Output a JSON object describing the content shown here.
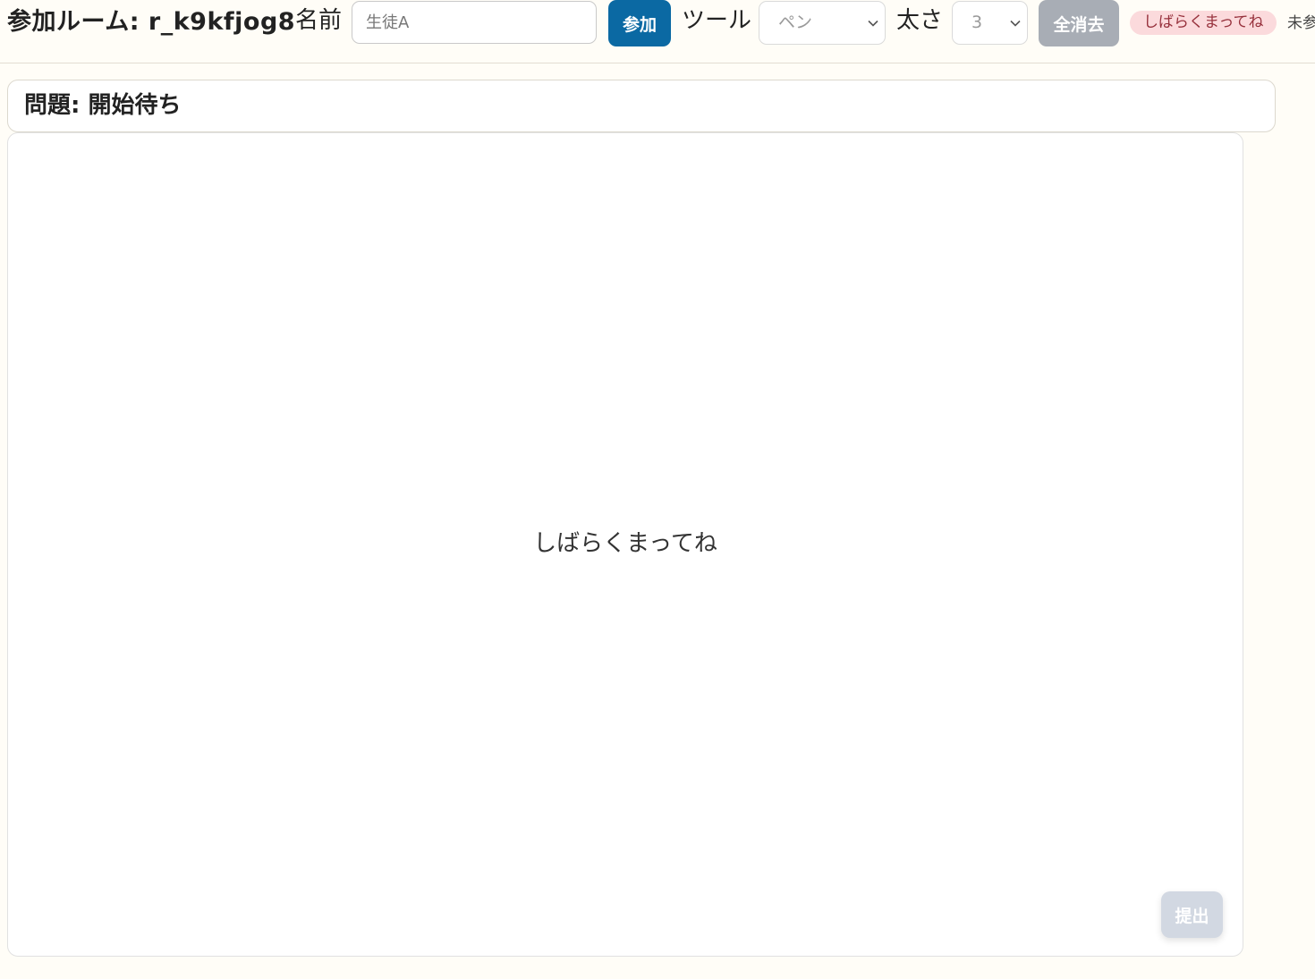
{
  "header": {
    "room_title": "参加ルーム: r_k9kfjog8",
    "name_label": "名前",
    "name_placeholder": "生徒A",
    "join_label": "参加",
    "tool_label": "ツール",
    "tool_selected": "ペン",
    "width_label": "太さ",
    "width_selected": "3",
    "clear_label": "全消去",
    "status_badge": "しばらくまってね",
    "join_status": "未参加"
  },
  "question": {
    "text": "問題: 開始待ち"
  },
  "canvas": {
    "wait_message": "しばらくまってね",
    "submit_label": "提出"
  },
  "icons": {
    "select_arrow": "chevron-down-icon"
  },
  "colors": {
    "page_background": "#fffdf7",
    "join_button": "#0b69a3",
    "clear_button_disabled": "#a8adb5",
    "status_badge_bg": "#fbdadc",
    "status_badge_text": "#96303b",
    "submit_button_disabled": "#d2d8e2"
  }
}
